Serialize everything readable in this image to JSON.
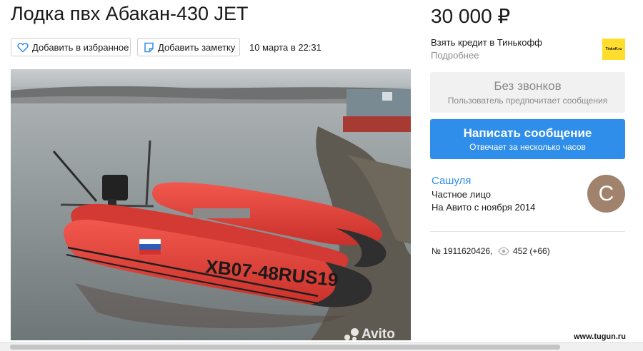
{
  "listing": {
    "title": "Лодка пвх Абакан-430 JET",
    "favorite_label": "Добавить в избранное",
    "note_label": "Добавить заметку",
    "date": "10 марта в 22:31"
  },
  "photo": {
    "hull_registration": "XB07-48RUS19",
    "watermark": "Avito"
  },
  "sidebar": {
    "price": "30 000 ₽",
    "credit_link": "Взять кредит в Тинькофф",
    "credit_more": "Подробнее",
    "tinkoff_logo_text": "Tinkoff.ru",
    "no_calls_title": "Без звонков",
    "no_calls_sub": "Пользователь предпочитает сообщения",
    "write_title": "Написать сообщение",
    "write_sub": "Отвечает за несколько часов",
    "seller_name": "Сашуля",
    "seller_type": "Частное лицо",
    "seller_since": "На Авито с ноября 2014",
    "avatar_letter": "С",
    "item_id": "№ 1911620426,",
    "views": "452 (+66)"
  },
  "site_watermark": "www.tugun.ru",
  "colors": {
    "accent": "#2f8ee9",
    "boat": "#e8473e",
    "tinkoff": "#ffdd2d",
    "avatar": "#a0826d"
  }
}
